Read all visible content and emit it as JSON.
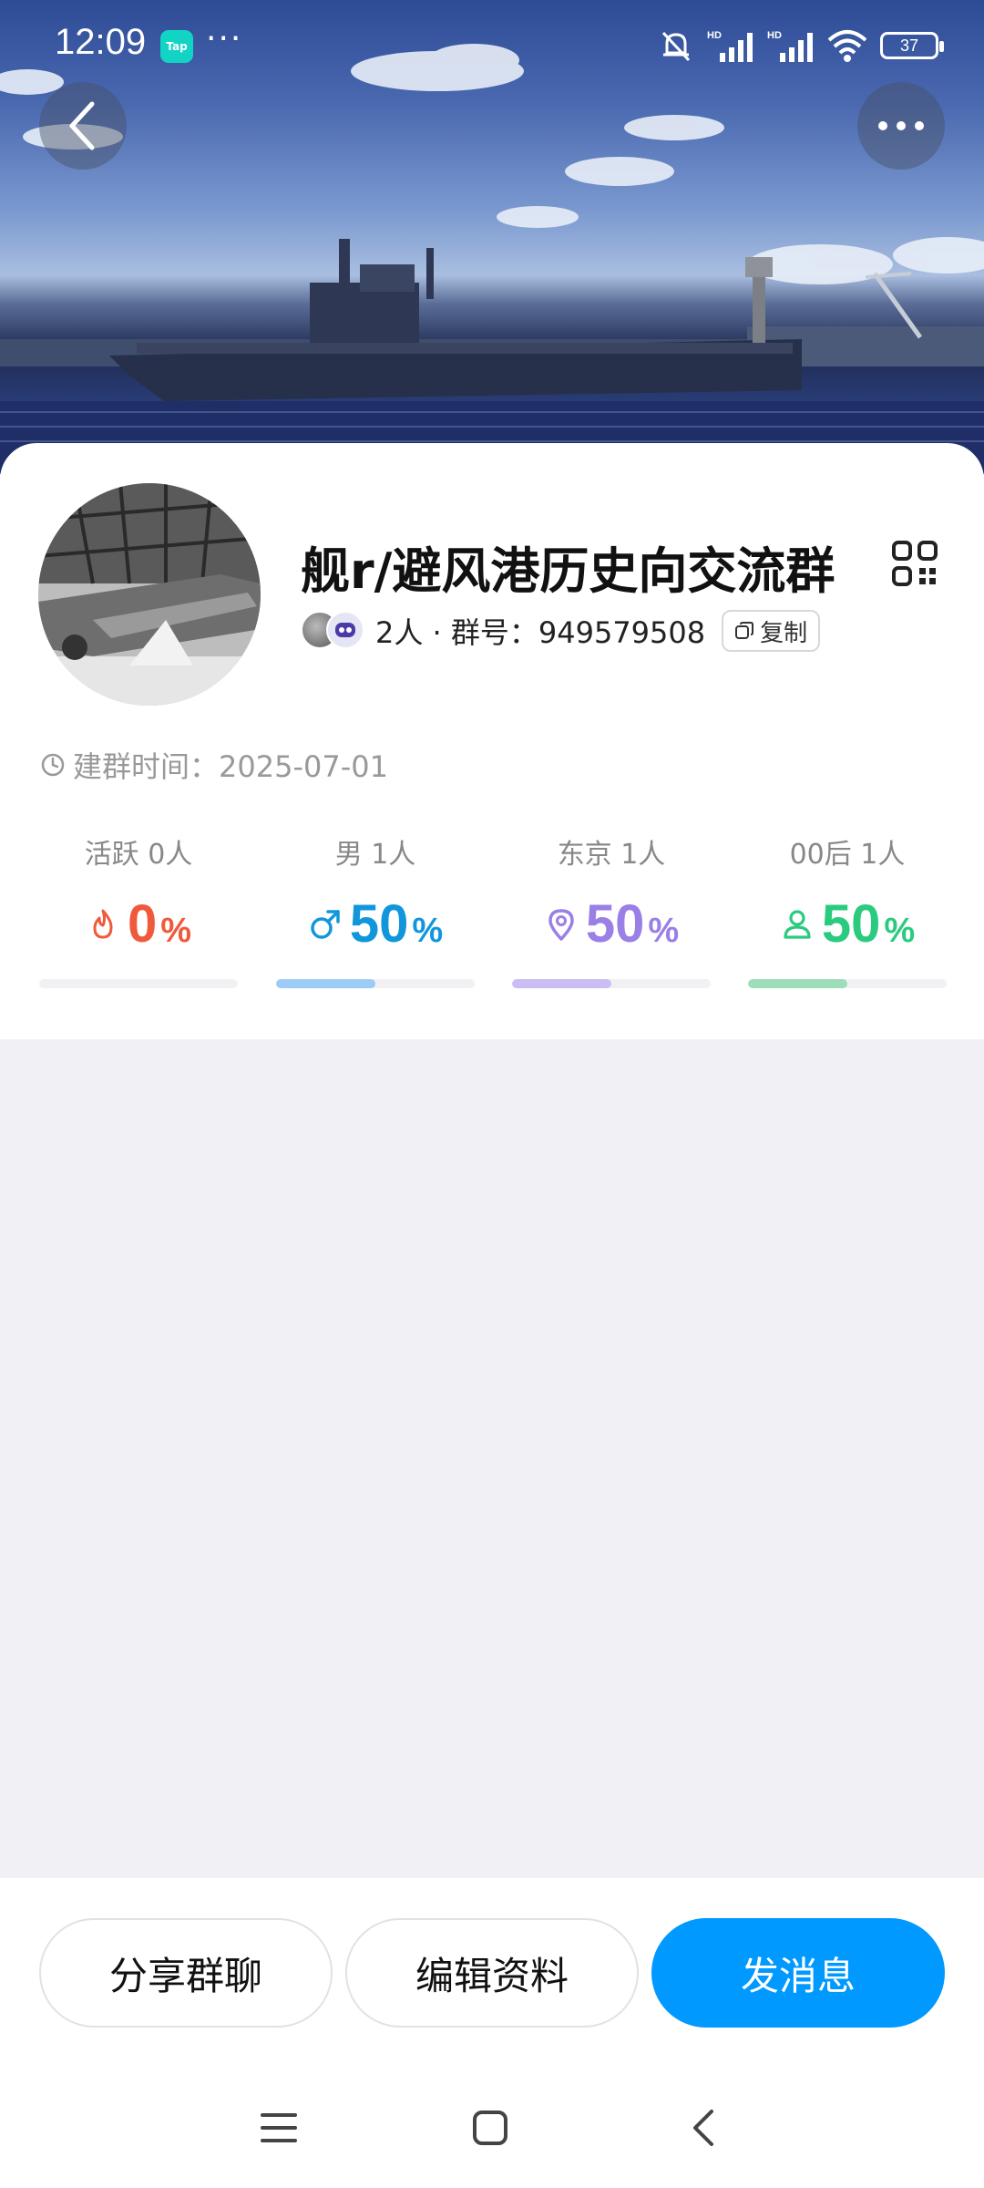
{
  "status_bar": {
    "time": "12:09",
    "app_badge": "Tap",
    "battery": "37"
  },
  "group": {
    "name": "舰r/避风港历史向交流群",
    "members_line": "2人 · 群号：949579508",
    "copy_label": "复制",
    "created_label": "建群时间：2025-07-01"
  },
  "stats": [
    {
      "label": "活跃 0人",
      "value": "0",
      "unit": "%",
      "color": "#F05A3C",
      "bar_color": "#F05A3C",
      "fraction": 0.0,
      "icon": "flame-icon"
    },
    {
      "label": "男 1人",
      "value": "50",
      "unit": "%",
      "color": "#1296DB",
      "bar_color": "#9CCBF5",
      "fraction": 0.5,
      "icon": "male-icon"
    },
    {
      "label": "东京 1人",
      "value": "50",
      "unit": "%",
      "color": "#9A7FE6",
      "bar_color": "#C9BDF4",
      "fraction": 0.5,
      "icon": "location-icon"
    },
    {
      "label": "00后 1人",
      "value": "50",
      "unit": "%",
      "color": "#2BCB7F",
      "bar_color": "#9EDDBA",
      "fraction": 0.5,
      "icon": "person-icon"
    }
  ],
  "actions": {
    "share": "分享群聊",
    "edit": "编辑资料",
    "send": "发消息"
  }
}
